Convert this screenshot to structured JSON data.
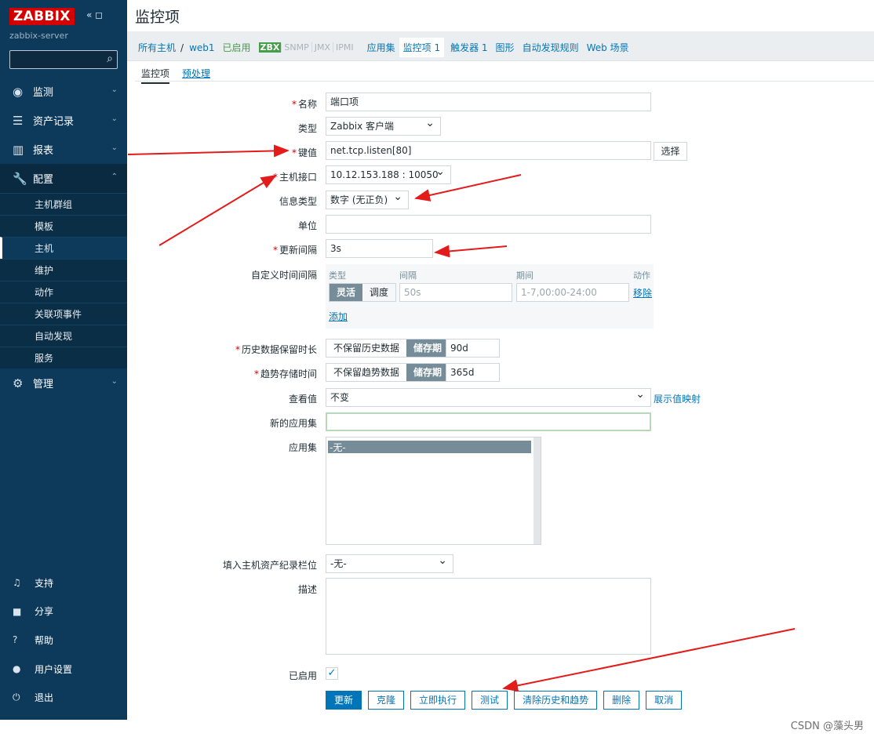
{
  "sidebar": {
    "logo": "ZABBIX",
    "server": "zabbix-server",
    "menu": [
      "监测",
      "资产记录",
      "报表",
      "配置",
      "管理"
    ],
    "sub": [
      "主机群组",
      "模板",
      "主机",
      "维护",
      "动作",
      "关联项事件",
      "自动发现",
      "服务"
    ],
    "bottom": [
      "支持",
      "分享",
      "帮助",
      "用户设置",
      "退出"
    ]
  },
  "header": {
    "title": "监控项",
    "crumbs": {
      "all_hosts": "所有主机",
      "host": "web1",
      "enabled": "已启用",
      "zbx": "ZBX",
      "snmp": "SNMP",
      "jmx": "JMX",
      "ipmi": "IPMI",
      "apps": "应用集",
      "items": "监控项 1",
      "triggers": "触发器 1",
      "graphs": "图形",
      "discovery": "自动发现规则",
      "web": "Web 场景"
    },
    "tabs": [
      "监控项",
      "预处理"
    ]
  },
  "form": {
    "name_label": "名称",
    "name": "端口项",
    "type_label": "类型",
    "type": "Zabbix 客户端",
    "key_label": "键值",
    "key": "net.tcp.listen[80]",
    "select": "选择",
    "iface_label": "主机接口",
    "iface": "10.12.153.188 : 10050",
    "info_label": "信息类型",
    "info": "数字 (无正负)",
    "unit_label": "单位",
    "interval_label": "更新间隔",
    "interval": "3s",
    "custom_label": "自定义时间间隔",
    "custom_headers": [
      "类型",
      "间隔",
      "期间",
      "动作"
    ],
    "flexible": "灵活",
    "scheduling": "调度",
    "interval_ph": "50s",
    "period_ph": "1-7,00:00-24:00",
    "remove": "移除",
    "add": "添加",
    "history_label": "历史数据保留时长",
    "history_off": "不保留历史数据",
    "storage": "储存期",
    "history": "90d",
    "trend_label": "趋势存储时间",
    "trend_off": "不保留趋势数据",
    "trend": "365d",
    "showvalue_label": "查看值",
    "showvalue": "不变",
    "mapping": "展示值映射",
    "newapp_label": "新的应用集",
    "apps_label": "应用集",
    "app_none": "-无-",
    "inventory_label": "填入主机资产纪录栏位",
    "inventory": "-无-",
    "desc_label": "描述",
    "enabled_label": "已启用",
    "check": "✓"
  },
  "buttons": [
    "更新",
    "克隆",
    "立即执行",
    "测试",
    "清除历史和趋势",
    "删除",
    "取消"
  ],
  "watermark": "CSDN @藻头男"
}
